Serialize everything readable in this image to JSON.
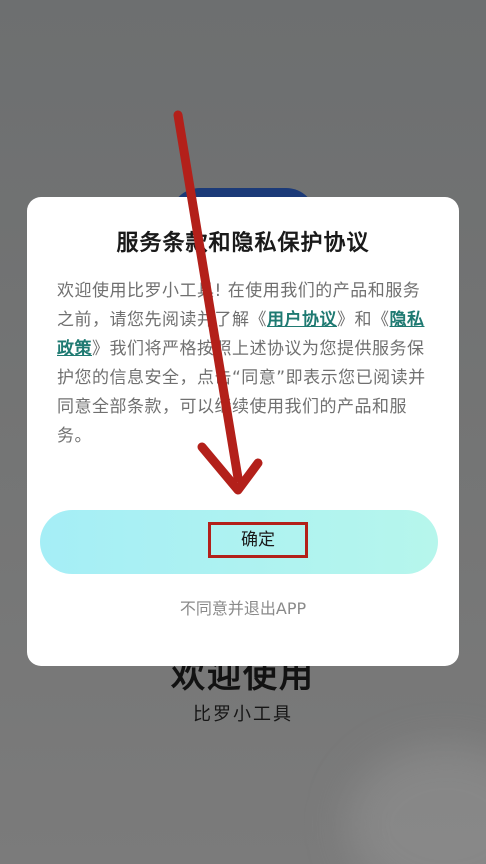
{
  "background": {
    "app_title": "欢迎使用",
    "app_subtitle": "比罗小工具"
  },
  "dialog": {
    "title": "服务条款和隐私保护协议",
    "body": {
      "part1": "欢迎使用比罗小工具! 在使用我们的产品和服务之前，请您先阅读并了解《",
      "link_user_agreement": "用户协议",
      "part2": "》和《",
      "link_privacy_policy": "隐私政策",
      "part3": "》我们将严格按照上述协议为您提供服务保护您的信息安全，点击“同意”即表示您已阅读并同意全部条款，可以继续使用我们的产品和服务。"
    },
    "confirm_label": "确定",
    "decline_label": "不同意并退出APP"
  },
  "colors": {
    "link": "#1f7a72",
    "annotation": "#b3201a",
    "button_start": "#a5eef6",
    "button_end": "#b6f6ec"
  }
}
